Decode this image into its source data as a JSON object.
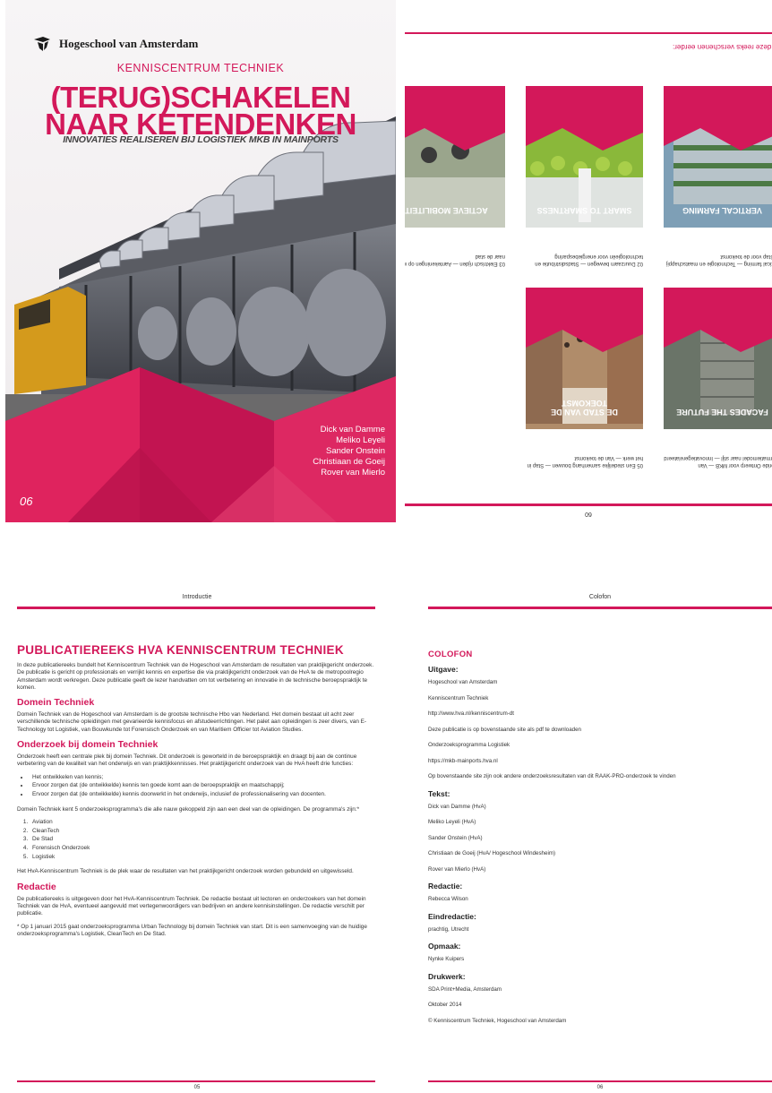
{
  "cover": {
    "logo_text": "Hogeschool van Amsterdam",
    "kenniscentrum": "KENNISCENTRUM TECHNIEK",
    "title_line1": "(TERUG)SCHAKELEN",
    "title_line2": "NAAR KETENDENKEN",
    "subtitle": "INNOVATIES REALISEREN BIJ LOGISTIEK MKB IN MAINPORTS",
    "authors": [
      "Dick van Damme",
      "Meliko Leyeli",
      "Sander Onstein",
      "Christiaan de Goeij",
      "Rover van Mierlo"
    ],
    "number": "06"
  },
  "series": {
    "heading": "n deze reeks verschenen eerder:",
    "page_number": "60",
    "books": [
      {
        "title": "VERTICAL FARMING",
        "caption": "Vertical farming — Technologie en maatschappij — Stap voor de toekomst"
      },
      {
        "title": "SMART TO SMARTNESS",
        "caption": "02 Duurzaam bewegen — Stadsdistributie en technologieën voor energiebesparing"
      },
      {
        "title": "ACTIEVE MOBILITEIT",
        "caption": "03 Elektrisch rijden — Aantekeningen op weg naar de stad"
      },
      {
        "title": "FACADES THE FUTURE",
        "caption": "Hybride Ontwerp voor MKB — Van informatiemodel naar stijl — Innovatiegerelateerd"
      },
      {
        "title": "DE STAD VAN DE TOEKOMST",
        "caption": "05 Een stedelijke samenhang bouwen — Stap in het werk — Van de toekomst"
      }
    ]
  },
  "intro": {
    "running_head": "Introductie",
    "title": "PUBLICATIEREEKS HVA KENNISCENTRUM TECHNIEK",
    "p1": "In deze publicatiereeks bundelt het Kenniscentrum Techniek van de Hogeschool van Amsterdam de resultaten van praktijkgericht onderzoek. De publicatie is gericht op professionals en verrijkt kennis en expertise die via praktijkgericht onderzoek van de HvA te de metropoolregio Amsterdam wordt verkregen. Deze publicatie geeft de lezer handvatten om tot verbetering en innovatie in de technische beroepspraktijk te komen.",
    "h_domein": "Domein Techniek",
    "p2": "Domein Techniek van de Hogeschool van Amsterdam is de grootste technische Hbo van Nederland. Het domein bestaat uit acht zeer verschillende technische opleidingen met gevarieerde kennisfocus en afstudeerrichtingen. Het palet aan opleidingen is zeer divers, van E-Technology tot Logistiek, van Bouwkunde tot Forensisch Onderzoek en van Maritiem Officier tot Aviation Studies.",
    "h_onderzoek": "Onderzoek bij domein Techniek",
    "p3": "Onderzoek heeft een centrale plek bij domein Techniek. Dit onderzoek is geworteld in de beroepspraktijk en draagt bij aan de continue verbetering van de kwaliteit van het onderwijs en van praktijkkennisses. Het praktijkgericht onderzoek van de HvA heeft drie functies:",
    "bullets": [
      "Het ontwikkelen van kennis;",
      "Ervoor zorgen dat (de ontwikkelde) kennis ten goede komt aan de beroepspraktijk en maatschappij;",
      "Ervoor zorgen dat (de ontwikkelde) kennis doorwerkt in het onderwijs, inclusief de professionalisering van docenten."
    ],
    "p4": "Domein Techniek kent 5 onderzoeksprogramma's die alle nauw gekoppeld zijn aan een deel van de opleidingen. De programma's zijn:*",
    "programs": [
      "Aviation",
      "CleanTech",
      "De Stad",
      "Forensisch Onderzoek",
      "Logistiek"
    ],
    "p5": "Het HvA-Kenniscentrum Techniek is de plek waar de resultaten van het praktijkgericht onderzoek worden gebundeld en uitgewisseld.",
    "h_redactie": "Redactie",
    "p6": "De publicatiereeks is uitgegeven door het HvA-Kenniscentrum Techniek. De redactie bestaat uit lectoren en onderzoekers van het domein Techniek van de HvA, eventueel aangevuld met vertegenwoordigers van bedrijven en andere kennisinstellingen. De redactie verschilt per publicatie.",
    "note": "* Op 1 januari 2015 gaat onderzoeksprogramma Urban Technology bij domein Techniek van start. Dit is een samenvoeging van de huidige onderzoeksprogramma's Logistiek, CleanTech en De Stad.",
    "page_number": "05"
  },
  "colofon": {
    "running_head": "Colofon",
    "title": "COLOFON",
    "sections": [
      {
        "label": "Uitgave:",
        "values": [
          "Hogeschool van Amsterdam",
          "Kenniscentrum Techniek",
          "http://www.hva.nl/kenniscentrum-dt",
          "Deze publicatie is op bovenstaande site als pdf te downloaden",
          "Onderzoeksprogramma Logistiek",
          "https://mkb-mainports.hva.nl",
          "Op bovenstaande site zijn ook andere onderzoeksresultaten van dit RAAK-PRO-onderzoek te vinden"
        ]
      },
      {
        "label": "Tekst:",
        "values": [
          "Dick van Damme (HvA)",
          "Meliko Leyeli (HvA)",
          "Sander Onstein (HvA)",
          "Christiaan de Goeij (HvA/ Hogeschool Windesheim)",
          "Rover van Mierlo (HvA)"
        ]
      },
      {
        "label": "Redactie:",
        "values": [
          "Rebecca Wilson"
        ]
      },
      {
        "label": "Eindredactie:",
        "values": [
          "prachtig, Utrecht"
        ]
      },
      {
        "label": "Opmaak:",
        "values": [
          "Nynke Kuipers"
        ]
      },
      {
        "label": "Drukwerk:",
        "values": [
          "SDA Print+Media, Amsterdam",
          "Oktober 2014",
          "© Kenniscentrum Techniek, Hogeschool van Amsterdam"
        ]
      }
    ],
    "page_number": "06"
  },
  "colors": {
    "accent": "#d3185a"
  }
}
